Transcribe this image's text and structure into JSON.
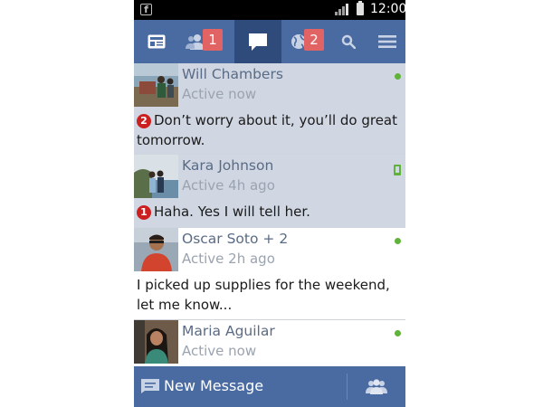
{
  "status_bar": {
    "app_icon": "facebook-notification-icon",
    "app_icon_glyph": "f",
    "time": "12:00"
  },
  "nav": {
    "items": [
      {
        "name": "news-feed",
        "icon": "news-feed-icon",
        "badge": ""
      },
      {
        "name": "friend-requests",
        "icon": "friend-requests-icon",
        "badge": "1"
      },
      {
        "name": "messages",
        "icon": "messages-icon",
        "badge": "",
        "active": true
      },
      {
        "name": "notifications",
        "icon": "globe-icon",
        "badge": "2"
      },
      {
        "name": "search",
        "icon": "search-icon",
        "badge": ""
      },
      {
        "name": "menu",
        "icon": "menu-icon",
        "badge": ""
      }
    ]
  },
  "conversations": [
    {
      "name": "Will Chambers",
      "presence": "Active now",
      "unread_count": "2",
      "message": "Don’t worry about it, you’ll do great tomorrow.",
      "unread": true,
      "status": "online"
    },
    {
      "name": "Kara Johnson",
      "presence": "Active 4h ago",
      "unread_count": "1",
      "message": "Haha. Yes I will tell her.",
      "unread": true,
      "status": "mobile"
    },
    {
      "name": "Oscar Soto + 2",
      "presence": "Active 2h ago",
      "unread_count": "",
      "message": "I picked up supplies for the weekend, let me know...",
      "unread": false,
      "status": "online"
    },
    {
      "name": "Maria Aguilar",
      "presence": "Active now",
      "unread_count": "",
      "message": "",
      "unread": false,
      "status": "online"
    }
  ],
  "bottom_bar": {
    "new_message_label": "New Message",
    "new_message_icon": "compose-icon",
    "group_icon": "group-icon"
  },
  "colors": {
    "nav_bar": "#4a6ba1",
    "nav_active": "#2f4b7c",
    "badge": "#e26363",
    "unread_row": "#d0d7e2",
    "online": "#5fb33a"
  }
}
